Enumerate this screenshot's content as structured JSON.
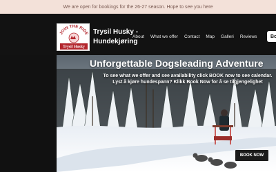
{
  "announcement": "We are open for bookings for the 26-27 season. Hope to see you here",
  "header": {
    "logo_top_text": "JOIN THE RIDE",
    "logo_bottom_text": "Trysil Husky",
    "brand_line1": "Trysil Husky -",
    "brand_line2": "Hundekjøring",
    "nav": [
      "About",
      "What we offer",
      "Contact",
      "Map",
      "Galleri",
      "Reviews"
    ],
    "book_label": "Bo"
  },
  "hero": {
    "title": "Unforgettable Dogsleading Adventure",
    "subtitle_en": "To see what we offer and see availability click BOOK now to see calendar.",
    "subtitle_no": "Lyst å kjøre hundespann? Klikk Book Now for å se tilgjengelighet",
    "cta_label": "BOOK NOW"
  },
  "colors": {
    "announcement_bg": "#f3e1d9",
    "header_bg": "#121212",
    "logo_red": "#b3262d"
  }
}
